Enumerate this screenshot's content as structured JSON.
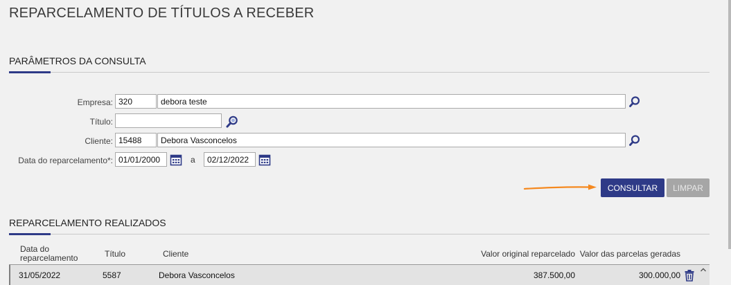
{
  "page": {
    "title": "REPARCELAMENTO DE TÍTULOS A RECEBER"
  },
  "params": {
    "title": "PARÂMETROS DA CONSULTA",
    "empresa": {
      "label": "Empresa:",
      "code": "320",
      "name": "debora teste"
    },
    "titulo": {
      "label": "Título:",
      "value": ""
    },
    "cliente": {
      "label": "Cliente:",
      "code": "15488",
      "name": "Debora Vasconcelos"
    },
    "data": {
      "label": "Data do reparcelamento*:",
      "from": "01/01/2000",
      "sep": "a",
      "to": "02/12/2022"
    },
    "buttons": {
      "consultar": "CONSULTAR",
      "limpar": "LIMPAR"
    }
  },
  "results": {
    "title": "REPARCELAMENTO REALIZADOS",
    "columns": {
      "data": "Data do reparcelamento",
      "titulo": "Título",
      "cliente": "Cliente",
      "valor_original": "Valor original reparcelado",
      "valor_parcelas": "Valor das parcelas geradas"
    },
    "rows": [
      {
        "data": "31/05/2022",
        "titulo": "5587",
        "cliente": "Debora Vasconcelos",
        "valor_original": "387.500,00",
        "valor_parcelas": "300.000,00"
      }
    ]
  },
  "colors": {
    "accent": "#2e3a87",
    "arrow": "#f5891f",
    "disabled": "#a6a6a6"
  },
  "icons": [
    "search-icon",
    "calendar-icon",
    "trash-icon",
    "chevron-up-icon",
    "arrow-annotation"
  ]
}
